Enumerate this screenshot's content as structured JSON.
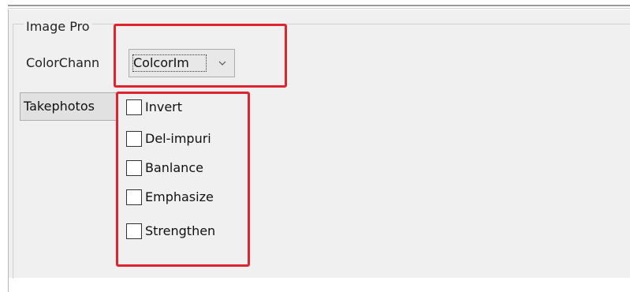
{
  "group": {
    "title": "Image Pro"
  },
  "color_channel": {
    "label": "ColorChann",
    "selected_value": "ColcorIm"
  },
  "buttons": {
    "takephotos_label": "Takephotos"
  },
  "checkboxes": [
    {
      "label": "Invert",
      "checked": false
    },
    {
      "label": "Del-impuri",
      "checked": false
    },
    {
      "label": "Banlance",
      "checked": false
    },
    {
      "label": "Emphasize",
      "checked": false
    },
    {
      "label": "Strengthen",
      "checked": false
    }
  ],
  "colors": {
    "highlight_border": "#e0242f",
    "panel_background": "#f0f0f0"
  },
  "icons": {
    "combo_arrow": "chevron-down-icon"
  }
}
